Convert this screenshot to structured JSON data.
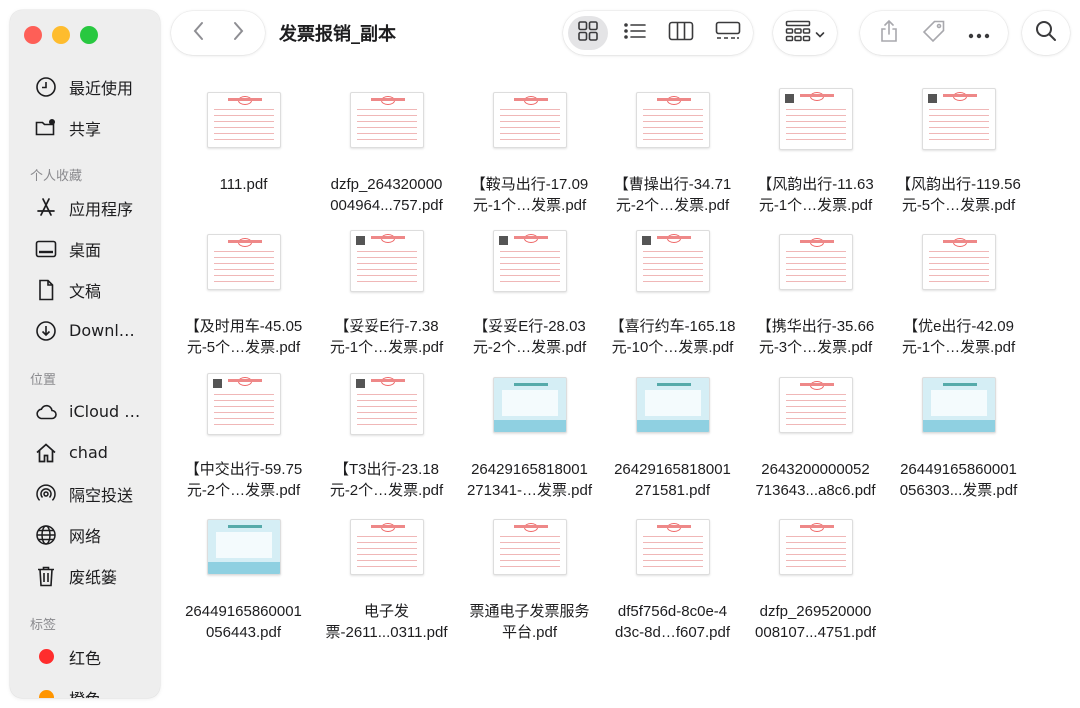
{
  "window": {
    "title": "发票报销_副本"
  },
  "sidebar": {
    "favorites": [
      {
        "label": "最近使用",
        "icon": "clock-icon"
      },
      {
        "label": "共享",
        "icon": "shared-folder-icon"
      }
    ],
    "sections": [
      {
        "heading": "个人收藏",
        "items": [
          {
            "label": "应用程序",
            "icon": "applications-icon"
          },
          {
            "label": "桌面",
            "icon": "desktop-icon"
          },
          {
            "label": "文稿",
            "icon": "document-icon"
          },
          {
            "label": "Downl…",
            "icon": "download-icon"
          }
        ]
      },
      {
        "heading": "位置",
        "items": [
          {
            "label": "iCloud …",
            "icon": "cloud-icon"
          },
          {
            "label": "chad",
            "icon": "home-icon"
          },
          {
            "label": "隔空投送",
            "icon": "airdrop-icon"
          },
          {
            "label": "网络",
            "icon": "globe-icon"
          },
          {
            "label": "废纸篓",
            "icon": "trash-icon"
          }
        ]
      },
      {
        "heading": "标签",
        "items": [
          {
            "label": "红色",
            "color": "#ff2d2d"
          },
          {
            "label": "橙色",
            "color": "#ff9500"
          }
        ]
      }
    ]
  },
  "toolbar": {
    "back": "chevron-left-icon",
    "forward": "chevron-right-icon",
    "views": [
      "icon-grid-icon",
      "list-icon",
      "columns-icon",
      "gallery-icon"
    ],
    "group": "group-by-icon",
    "actions": [
      "share-icon",
      "tag-icon",
      "more-icon"
    ],
    "search": "search-icon"
  },
  "files": [
    {
      "name": "111.pdf",
      "thumb": "red"
    },
    {
      "name": "dzfp_264320000\n004964...757.pdf",
      "thumb": "red"
    },
    {
      "name": "【鞍马出行-17.09\n元-1个…发票.pdf",
      "thumb": "red"
    },
    {
      "name": "【曹操出行-34.71\n元-2个…发票.pdf",
      "thumb": "red"
    },
    {
      "name": "【风韵出行-11.63\n元-1个…发票.pdf",
      "thumb": "redtall"
    },
    {
      "name": "【风韵出行-119.56\n元-5个…发票.pdf",
      "thumb": "redtall"
    },
    {
      "name": "【及时用车-45.05\n元-5个…发票.pdf",
      "thumb": "red"
    },
    {
      "name": "【妥妥E行-7.38\n元-1个…发票.pdf",
      "thumb": "redtall"
    },
    {
      "name": "【妥妥E行-28.03\n元-2个…发票.pdf",
      "thumb": "redtall"
    },
    {
      "name": "【喜行约车-165.18\n元-10个…发票.pdf",
      "thumb": "redtall"
    },
    {
      "name": "【携华出行-35.66\n元-3个…发票.pdf",
      "thumb": "red"
    },
    {
      "name": "【优e出行-42.09\n元-1个…发票.pdf",
      "thumb": "red"
    },
    {
      "name": "【中交出行-59.75\n元-2个…发票.pdf",
      "thumb": "redtall"
    },
    {
      "name": "【T3出行-23.18\n元-2个…发票.pdf",
      "thumb": "redtall"
    },
    {
      "name": "26429165818001\n271341-…发票.pdf",
      "thumb": "blue"
    },
    {
      "name": "26429165818001\n271581.pdf",
      "thumb": "blue"
    },
    {
      "name": "2643200000052\n713643...a8c6.pdf",
      "thumb": "red"
    },
    {
      "name": "26449165860001\n056303...发票.pdf",
      "thumb": "blue"
    },
    {
      "name": "26449165860001\n056443.pdf",
      "thumb": "blue"
    },
    {
      "name": "电子发\n票-2611...0311.pdf",
      "thumb": "red"
    },
    {
      "name": "票通电子发票服务\n平台.pdf",
      "thumb": "red"
    },
    {
      "name": "df5f756d-8c0e-4\nd3c-8d…f607.pdf",
      "thumb": "red"
    },
    {
      "name": "dzfp_269520000\n008107...4751.pdf",
      "thumb": "red"
    }
  ]
}
